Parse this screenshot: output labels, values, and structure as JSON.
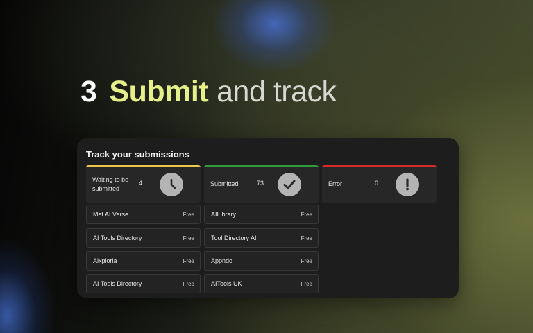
{
  "headline": {
    "number": "3",
    "accent": "Submit",
    "rest": "and track"
  },
  "panel": {
    "title": "Track your submissions",
    "stats": [
      {
        "label": "Waiting to be submitted",
        "count": "4",
        "icon": "clock-icon",
        "color": "#e9c84a"
      },
      {
        "label": "Submitted",
        "count": "73",
        "icon": "check-icon",
        "color": "#2f9a3e"
      },
      {
        "label": "Error",
        "count": "0",
        "icon": "exclamation-icon",
        "color": "#d72a2a"
      }
    ],
    "columns": [
      [
        {
          "name": "Met AI Verse",
          "price": "Free"
        },
        {
          "name": "AI Tools Directory",
          "price": "Free"
        },
        {
          "name": "Aixploria",
          "price": "Free"
        },
        {
          "name": "AI Tools Directory",
          "price": "Free"
        }
      ],
      [
        {
          "name": "AILibrary",
          "price": "Free"
        },
        {
          "name": "Tool Directory AI",
          "price": "Free"
        },
        {
          "name": "Appndo",
          "price": "Free"
        },
        {
          "name": "AITools UK",
          "price": "Free"
        }
      ]
    ]
  }
}
